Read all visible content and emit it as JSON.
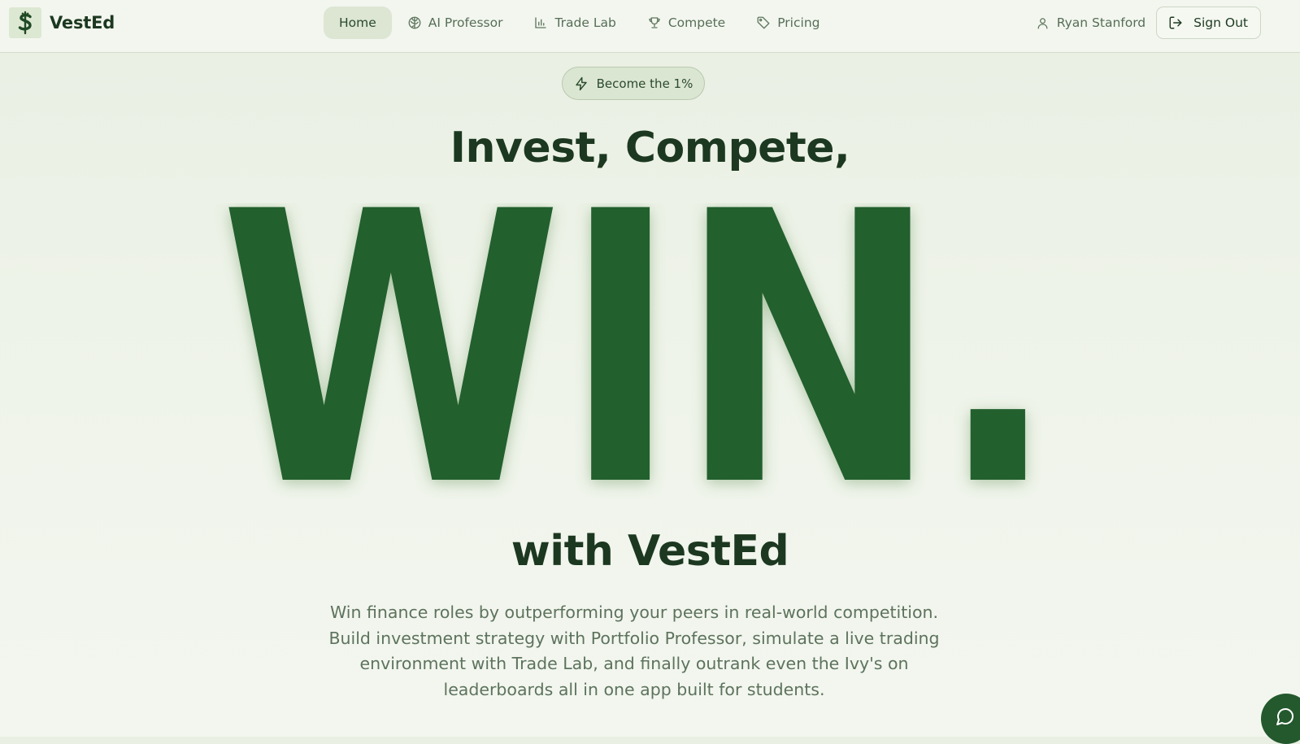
{
  "brand": {
    "name": "VestEd",
    "logo_icon": "dollar-sign-logo-icon"
  },
  "nav": {
    "items": [
      {
        "label": "Home",
        "icon": "",
        "active": true
      },
      {
        "label": "AI Professor",
        "icon": "brain-icon",
        "active": false
      },
      {
        "label": "Trade Lab",
        "icon": "bar-chart-icon",
        "active": false
      },
      {
        "label": "Compete",
        "icon": "trophy-icon",
        "active": false
      },
      {
        "label": "Pricing",
        "icon": "tag-icon",
        "active": false
      }
    ]
  },
  "user": {
    "name": "Ryan Stanford",
    "icon": "user-icon",
    "signout_label": "Sign Out",
    "signout_icon": "logout-icon"
  },
  "hero": {
    "badge": "Become the 1%",
    "badge_icon": "lightning-icon",
    "headline": "Invest, Compete,",
    "big_word": "WIN.",
    "subheadline": "with VestEd",
    "description": "Win finance roles by outperforming your peers in real-world competition. Build investment strategy with Portfolio Professor, simulate a live trading environment with Trade Lab, and finally outrank even the Ivy's on leaderboards all in one app built for students."
  },
  "chat": {
    "icon": "chat-bubble-icon"
  },
  "colors": {
    "primary_green": "#24612e",
    "dark_text": "#1c3820",
    "muted_text": "#5d735d",
    "background": "#eef3e9",
    "active_nav_bg": "#dce6d3"
  }
}
